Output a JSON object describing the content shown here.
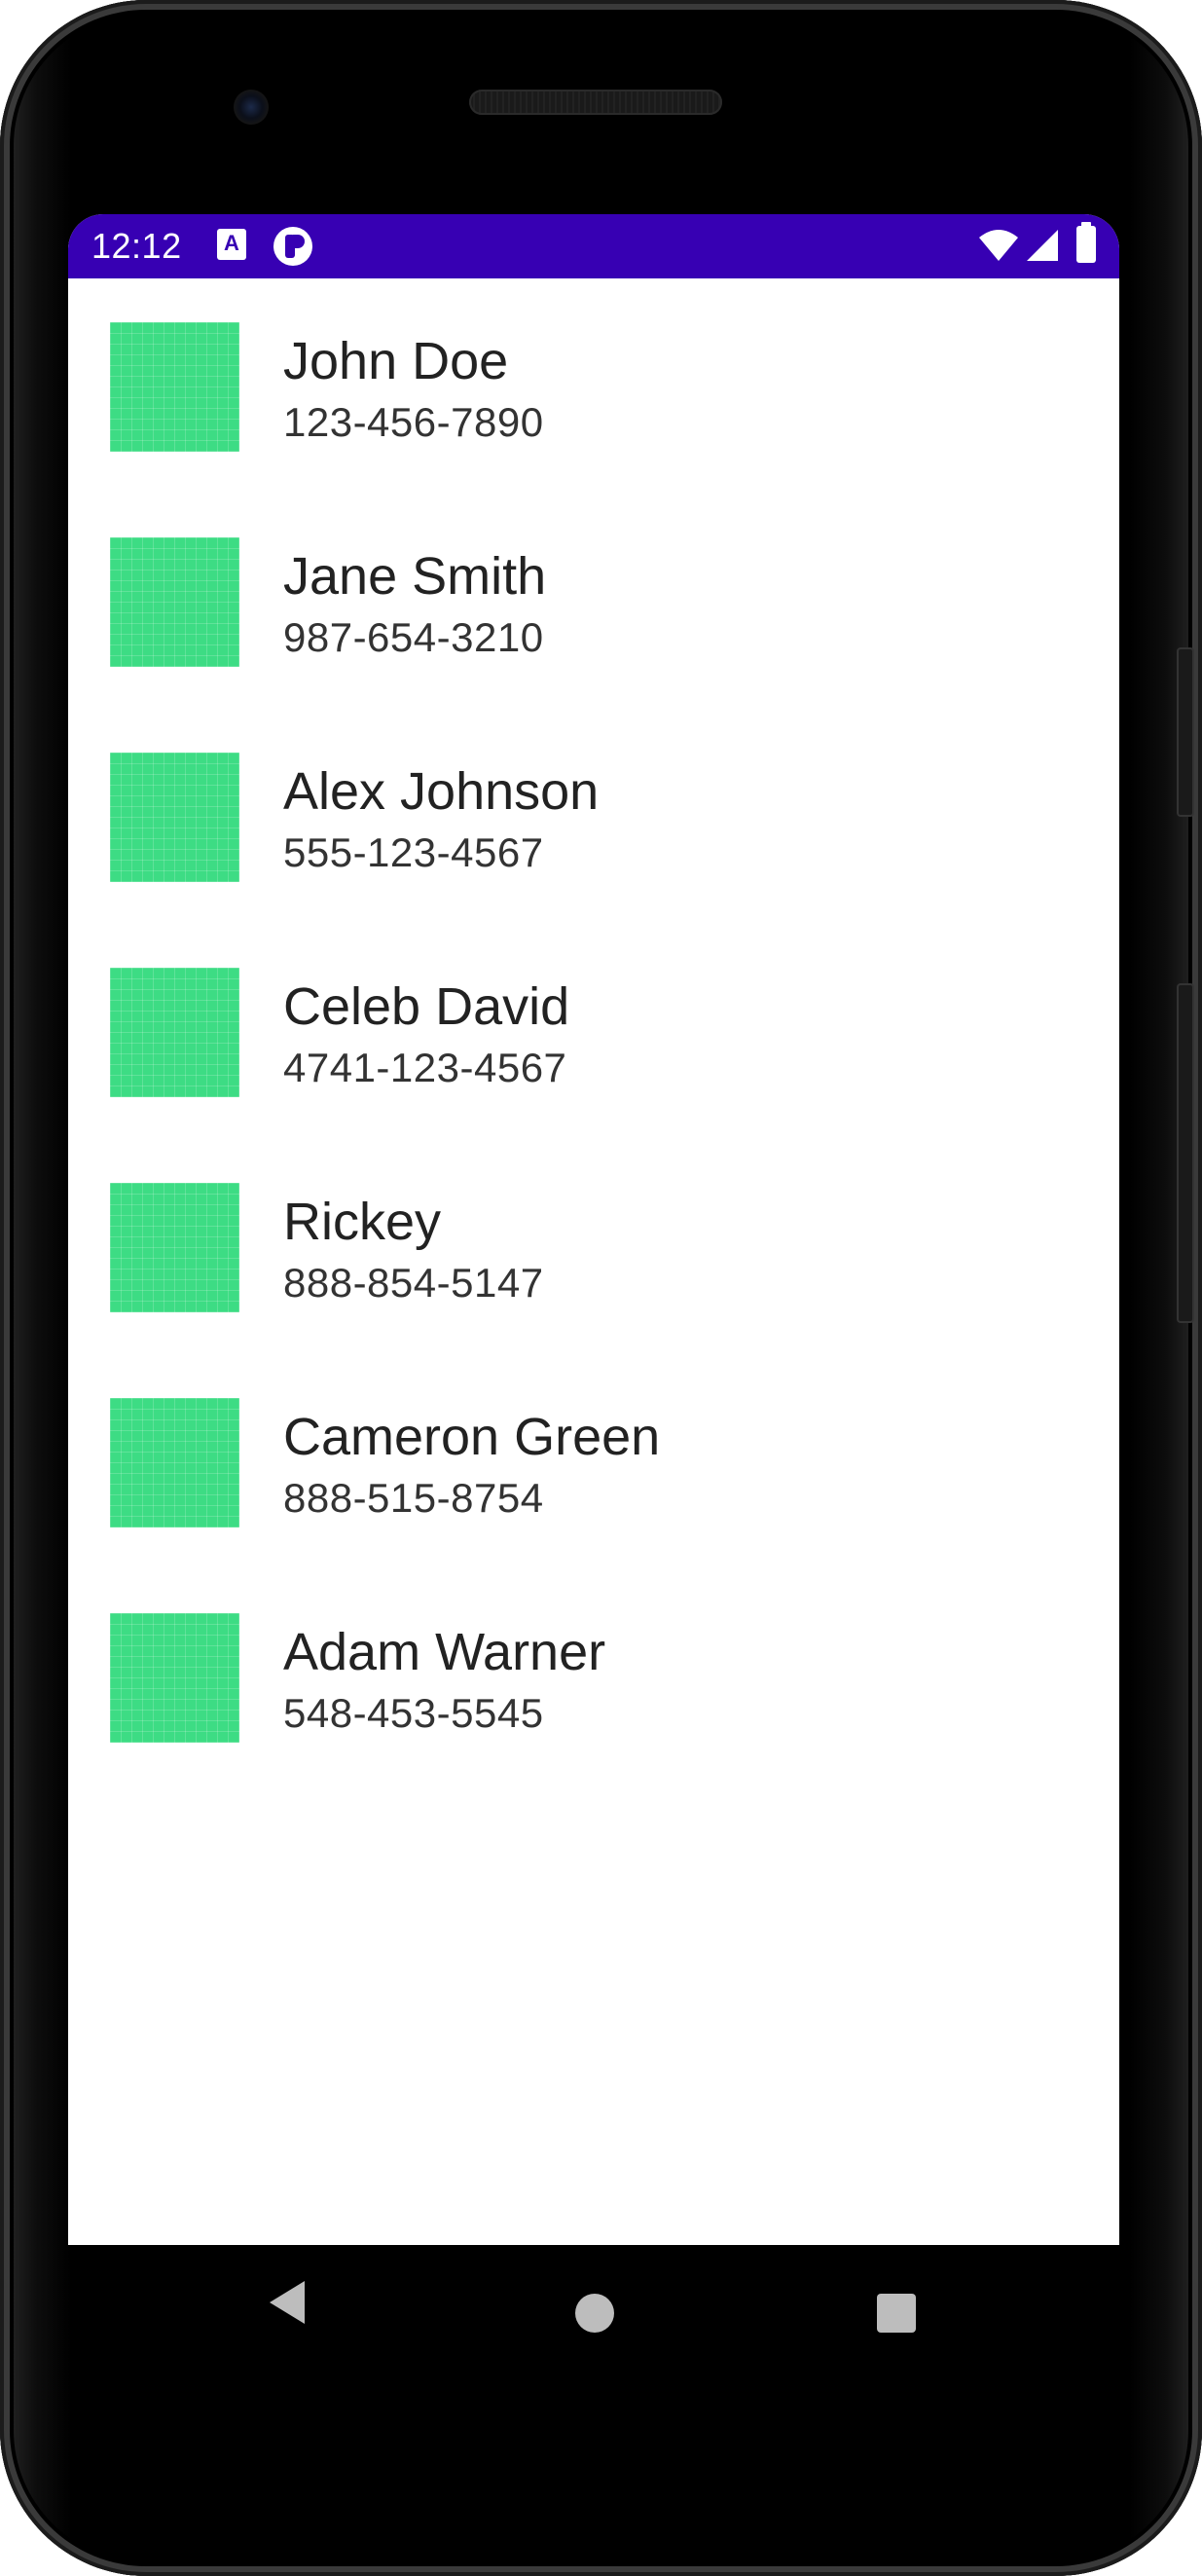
{
  "status_bar": {
    "time": "12:12",
    "color": "#3700b3",
    "icons": [
      "a-notification-icon",
      "p-notification-icon",
      "wifi-icon",
      "signal-icon",
      "battery-icon"
    ]
  },
  "contacts": [
    {
      "name": "John Doe",
      "phone": "123-456-7890"
    },
    {
      "name": "Jane Smith",
      "phone": "987-654-3210"
    },
    {
      "name": "Alex Johnson",
      "phone": "555-123-4567"
    },
    {
      "name": "Celeb David",
      "phone": "4741-123-4567"
    },
    {
      "name": "Rickey",
      "phone": "888-854-5147"
    },
    {
      "name": "Cameron Green",
      "phone": "888-515-8754"
    },
    {
      "name": "Adam Warner",
      "phone": "548-453-5545"
    }
  ],
  "avatar_color": "#3ddc84",
  "navigation": {
    "icons": [
      "back-icon",
      "home-icon",
      "recents-icon"
    ]
  }
}
